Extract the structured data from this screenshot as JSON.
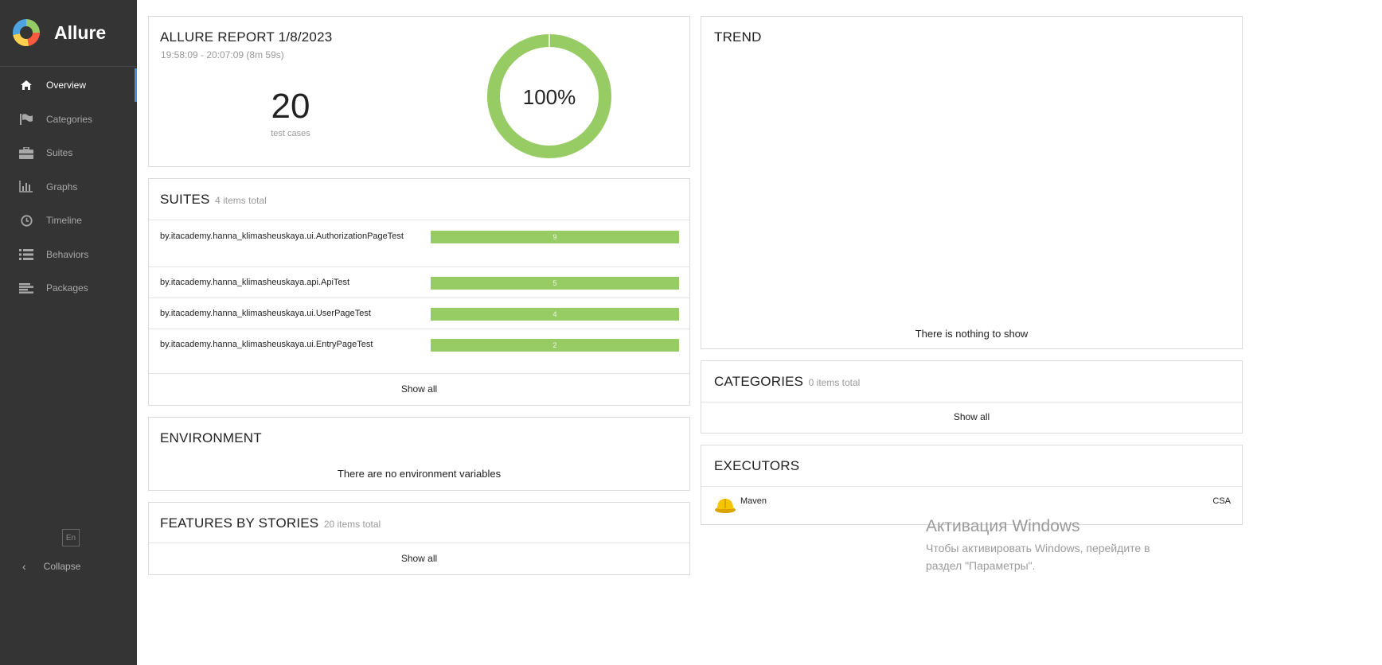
{
  "app": {
    "name": "Allure"
  },
  "sidebar": {
    "items": [
      {
        "label": "Overview",
        "icon": "home-icon",
        "active": true
      },
      {
        "label": "Categories",
        "icon": "flag-icon",
        "active": false
      },
      {
        "label": "Suites",
        "icon": "briefcase-icon",
        "active": false
      },
      {
        "label": "Graphs",
        "icon": "bar-chart-icon",
        "active": false
      },
      {
        "label": "Timeline",
        "icon": "clock-icon",
        "active": false
      },
      {
        "label": "Behaviors",
        "icon": "list-icon",
        "active": false
      },
      {
        "label": "Packages",
        "icon": "align-left-icon",
        "active": false
      }
    ],
    "language": "En",
    "collapse_label": "Collapse"
  },
  "summary": {
    "title": "ALLURE REPORT 1/8/2023",
    "time_range": "19:58:09 - 20:07:09 (8m 59s)",
    "test_count": "20",
    "test_count_label": "test cases",
    "pass_rate_label": "100%",
    "pass_rate": 1.0
  },
  "suites": {
    "title": "SUITES",
    "count_label": "4 items total",
    "rows": [
      {
        "name": "by.itacademy.hanna_klimasheuskaya.ui.AuthorizationPageTest",
        "count": "9"
      },
      {
        "name": "by.itacademy.hanna_klimasheuskaya.api.ApiTest",
        "count": "5"
      },
      {
        "name": "by.itacademy.hanna_klimasheuskaya.ui.UserPageTest",
        "count": "4"
      },
      {
        "name": "by.itacademy.hanna_klimasheuskaya.ui.EntryPageTest",
        "count": "2"
      }
    ],
    "show_all": "Show all"
  },
  "environment": {
    "title": "ENVIRONMENT",
    "empty_text": "There are no environment variables"
  },
  "features": {
    "title": "FEATURES BY STORIES",
    "count_label": "20 items total",
    "show_all": "Show all"
  },
  "trend": {
    "title": "TREND",
    "empty_text": "There is nothing to show"
  },
  "categories": {
    "title": "CATEGORIES",
    "count_label": "0 items total",
    "show_all": "Show all"
  },
  "executors": {
    "title": "EXECUTORS",
    "name": "Maven",
    "build": "CSA",
    "icon": "hard-hat-icon"
  },
  "watermark": {
    "title": "Активация Windows",
    "line1": "Чтобы активировать Windows, перейдите в",
    "line2": "раздел \"Параметры\"."
  },
  "colors": {
    "sidebar_bg": "#343434",
    "passed": "#97cc64",
    "active_indicator": "#4a90d9"
  }
}
